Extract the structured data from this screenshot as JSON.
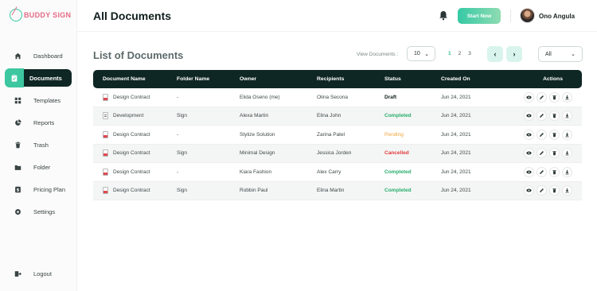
{
  "app": {
    "logo_text": "BUDDY SIGN"
  },
  "sidebar": {
    "items": [
      {
        "label": "Dashboard",
        "icon": "home-icon",
        "active": false
      },
      {
        "label": "Documents",
        "icon": "clipboard-icon",
        "active": true
      },
      {
        "label": "Templates",
        "icon": "grid-icon",
        "active": false
      },
      {
        "label": "Reports",
        "icon": "pie-chart-icon",
        "active": false
      },
      {
        "label": "Trash",
        "icon": "trash-icon",
        "active": false
      },
      {
        "label": "Folder",
        "icon": "folder-icon",
        "active": false
      },
      {
        "label": "Pricing Plan",
        "icon": "dollar-icon",
        "active": false
      },
      {
        "label": "Settings",
        "icon": "gear-icon",
        "active": false
      }
    ],
    "logout": {
      "label": "Logout",
      "icon": "logout-icon"
    }
  },
  "header": {
    "title": "All Documents",
    "start_button": "Start Now",
    "user_name": "Ono Angula"
  },
  "list": {
    "title": "List of Documents",
    "view_label": "View Documents :",
    "view_value": "10",
    "pages": [
      "1",
      "2",
      "3"
    ],
    "current_page": "1",
    "filter_value": "All"
  },
  "table": {
    "columns": [
      "Document Name",
      "Folder Name",
      "Owner",
      "Recipients",
      "Status",
      "Created On",
      "Actions"
    ],
    "rows": [
      {
        "doc": "Design Contract",
        "type": "pdf",
        "folder": "-",
        "owner": "Elida Oseno (me)",
        "recipient": "Olina Secona",
        "status": "Draft",
        "status_kind": "draft",
        "created": "Jun 24, 2021"
      },
      {
        "doc": "Development",
        "type": "doc",
        "folder": "Sign",
        "owner": "Alexa Martin",
        "recipient": "Elina John",
        "status": "Completed",
        "status_kind": "completed",
        "created": "Jun 24, 2021"
      },
      {
        "doc": "Design Contract",
        "type": "pdf",
        "folder": "-",
        "owner": "Stylize Solution",
        "recipient": "Zarina Patel",
        "status": "Pending",
        "status_kind": "pending",
        "created": "Jun 24, 2021"
      },
      {
        "doc": "Design Contract",
        "type": "pdf",
        "folder": "Sign",
        "owner": "Minimal Design",
        "recipient": "Jessica Jorden",
        "status": "Cancelled",
        "status_kind": "cancelled",
        "created": "Jun 24, 2021"
      },
      {
        "doc": "Design Contract",
        "type": "pdf",
        "folder": "-",
        "owner": "Kiara Fashion",
        "recipient": "Alex Carry",
        "status": "Completed",
        "status_kind": "completed",
        "created": "Jun 24, 2021"
      },
      {
        "doc": "Design Contract",
        "type": "pdf",
        "folder": "Sign",
        "owner": "Robbin Paul",
        "recipient": "Elina Martin",
        "status": "Completed",
        "status_kind": "completed",
        "created": "Jun 24, 2021"
      }
    ],
    "actions": [
      "view-icon",
      "edit-icon",
      "delete-icon",
      "download-icon"
    ]
  },
  "colors": {
    "accent": "#3cc7a0",
    "dark": "#0f2724",
    "completed": "#27ae6b",
    "pending": "#f0a43a",
    "cancelled": "#e23b3b"
  }
}
